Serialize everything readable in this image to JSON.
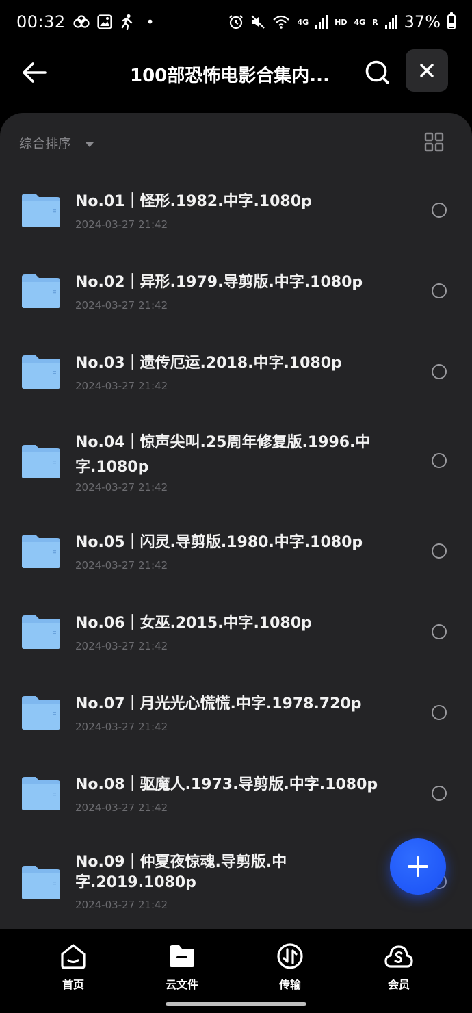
{
  "status_bar": {
    "time": "00:32",
    "battery": "37%",
    "network_left": "4G",
    "hd": "HD",
    "network_right": "4G",
    "roaming": "R",
    "dot": "•"
  },
  "header": {
    "title": "100部恐怖电影合集内..."
  },
  "sort": {
    "label": "综合排序"
  },
  "files": [
    {
      "name": "No.01｜怪形.1982.中字.1080p",
      "date": "2024-03-27 21:42"
    },
    {
      "name": "No.02｜异形.1979.导剪版.中字.1080p",
      "date": "2024-03-27 21:42"
    },
    {
      "name": "No.03｜遗传厄运.2018.中字.1080p",
      "date": "2024-03-27 21:42"
    },
    {
      "name": "No.04｜惊声尖叫.25周年修复版.1996.中字.1080p",
      "date": "2024-03-27 21:42"
    },
    {
      "name": "No.05｜闪灵.导剪版.1980.中字.1080p",
      "date": "2024-03-27 21:42"
    },
    {
      "name": "No.06｜女巫.2015.中字.1080p",
      "date": "2024-03-27 21:42"
    },
    {
      "name": "No.07｜月光光心慌慌.中字.1978.720p",
      "date": "2024-03-27 21:42"
    },
    {
      "name": "No.08｜驱魔人.1973.导剪版.中字.1080p",
      "date": "2024-03-27 21:42"
    },
    {
      "name": "No.09｜仲夏夜惊魂.导剪版.中字.2019.1080p",
      "date": "2024-03-27 21:42"
    }
  ],
  "nav": {
    "home": "首页",
    "cloud": "云文件",
    "transfer": "传输",
    "member": "会员"
  },
  "colors": {
    "accent": "#1a50f5",
    "folder": "#7fb8ef",
    "panel": "#242426"
  }
}
